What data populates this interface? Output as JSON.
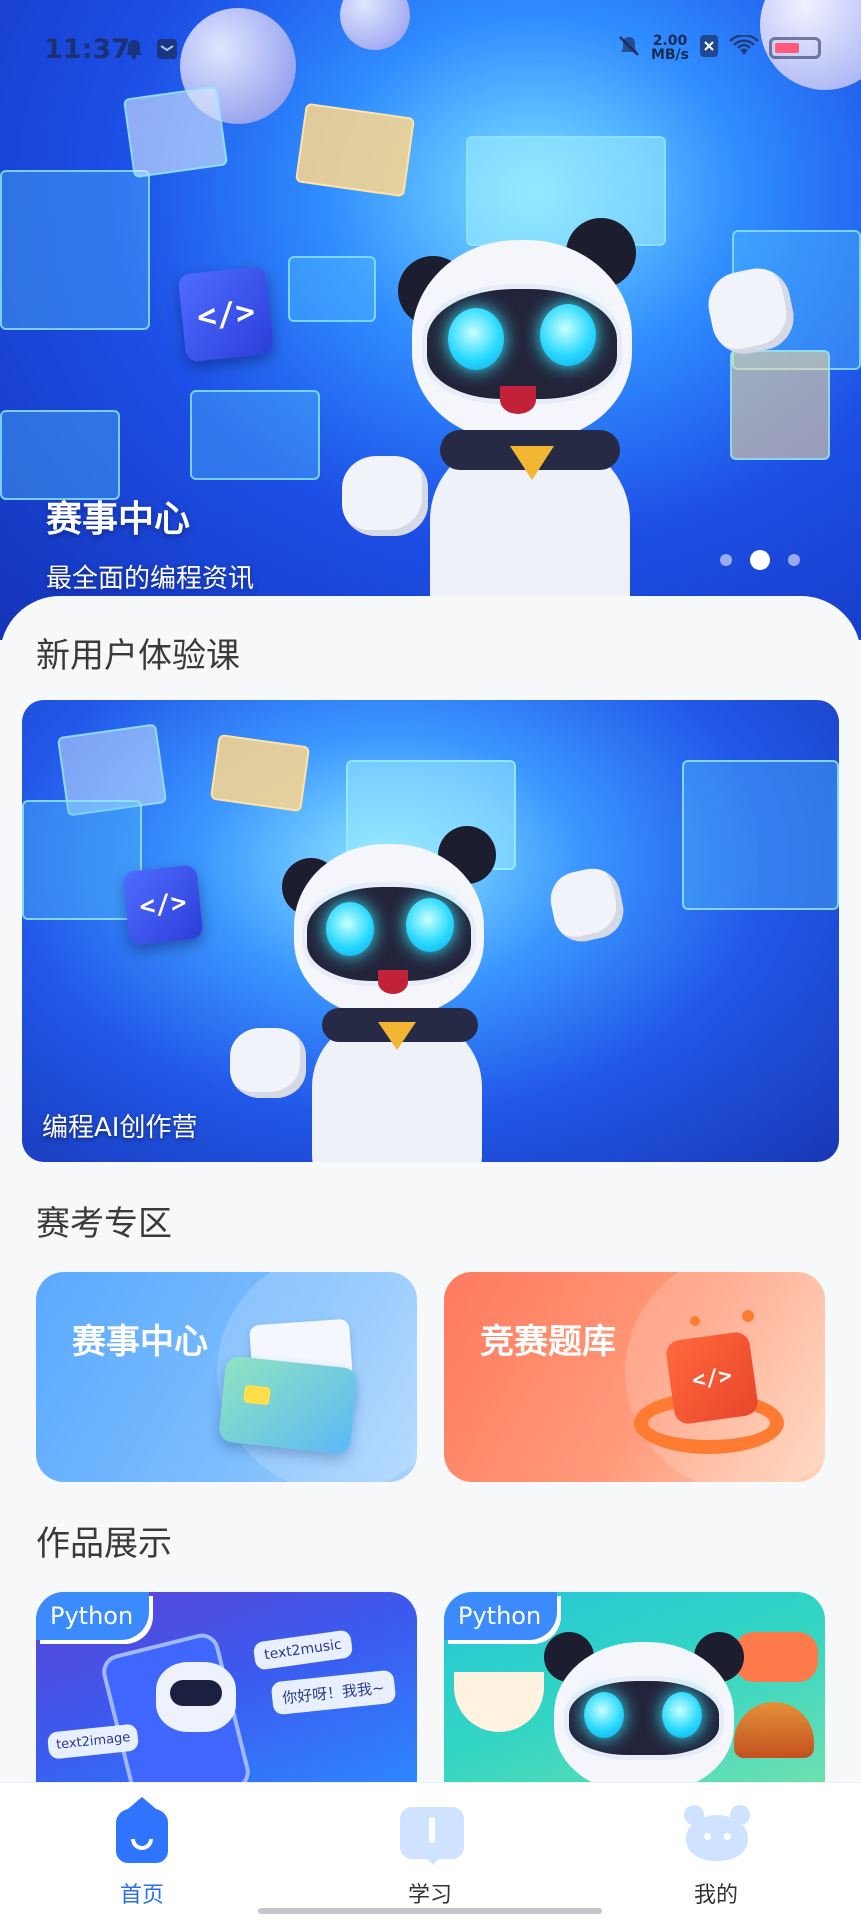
{
  "status_bar": {
    "time": "11:37",
    "speed_value": "2.00",
    "speed_unit": "MB/s"
  },
  "hero": {
    "title": "赛事中心",
    "subtitle": "最全面的编程资讯",
    "code_icon": "</>",
    "carousel_index": 2,
    "carousel_count": 3
  },
  "sections": {
    "trial": {
      "title": "新用户体验课",
      "card_label": "编程AI创作营"
    },
    "exam_zone": {
      "title": "赛考专区",
      "cards": [
        {
          "label": "赛事中心",
          "icon": "folder-icon",
          "color": "#5aa9ff"
        },
        {
          "label": "竞赛题库",
          "icon": "code-robot-icon",
          "color": "#ff7a5e"
        }
      ]
    },
    "works": {
      "title": "作品展示",
      "items": [
        {
          "tag": "Python",
          "bubble_1": "text2music",
          "bubble_2": "你好呀！我我~",
          "bubble_3": "text2image"
        },
        {
          "tag": "Python"
        }
      ]
    }
  },
  "tabbar": {
    "items": [
      {
        "label": "首页",
        "icon": "home-icon",
        "active": true
      },
      {
        "label": "学习",
        "icon": "study-icon",
        "active": false
      },
      {
        "label": "我的",
        "icon": "profile-bear-icon",
        "active": false
      }
    ],
    "active_color": "#2a6cf5"
  }
}
